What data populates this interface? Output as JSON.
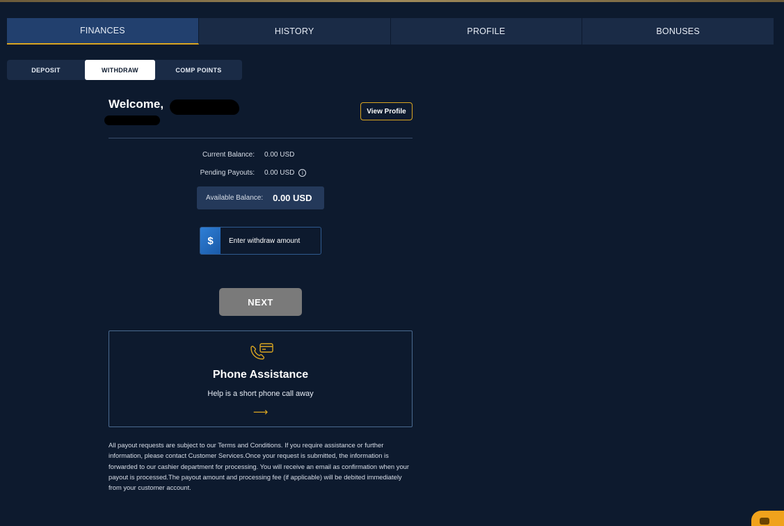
{
  "main_tabs": [
    {
      "label": "FINANCES",
      "active": true
    },
    {
      "label": "HISTORY",
      "active": false
    },
    {
      "label": "PROFILE",
      "active": false
    },
    {
      "label": "BONUSES",
      "active": false
    }
  ],
  "sub_tabs": [
    {
      "label": "DEPOSIT",
      "active": false
    },
    {
      "label": "WITHDRAW",
      "active": true
    },
    {
      "label": "COMP POINTS",
      "active": false
    }
  ],
  "welcome": {
    "greeting": "Welcome,"
  },
  "view_profile_label": "View Profile",
  "balances": {
    "current_label": "Current Balance:",
    "current_value": "0.00 USD",
    "pending_label": "Pending Payouts:",
    "pending_value": "0.00 USD",
    "available_label": "Available Balance:",
    "available_value": "0.00 USD"
  },
  "withdraw": {
    "currency_symbol": "$",
    "placeholder": "Enter withdraw amount",
    "next_label": "NEXT"
  },
  "phone_card": {
    "title": "Phone Assistance",
    "subtitle": "Help is a short phone call away",
    "arrow": "⟶"
  },
  "disclaimer": "All payout requests are subject to our Terms and Conditions. If you require assistance or further information, please contact Customer Services.Once your request is submitted, the information is forwarded to our cashier department for processing. You will receive an email as confirmation when your payout is processed.The payout amount and processing fee (if applicable) will be debited immediately from your customer account.",
  "colors": {
    "background": "#0d1a2e",
    "accent_gold": "#d9a521",
    "tab_active": "#22406e",
    "button_disabled": "#7a7a7a",
    "chat_orange": "#f0a21c"
  },
  "icons": {
    "phone_card_icon": "phone-card-icon",
    "info_icon": "info-icon",
    "chat_icon": "chat-icon"
  }
}
